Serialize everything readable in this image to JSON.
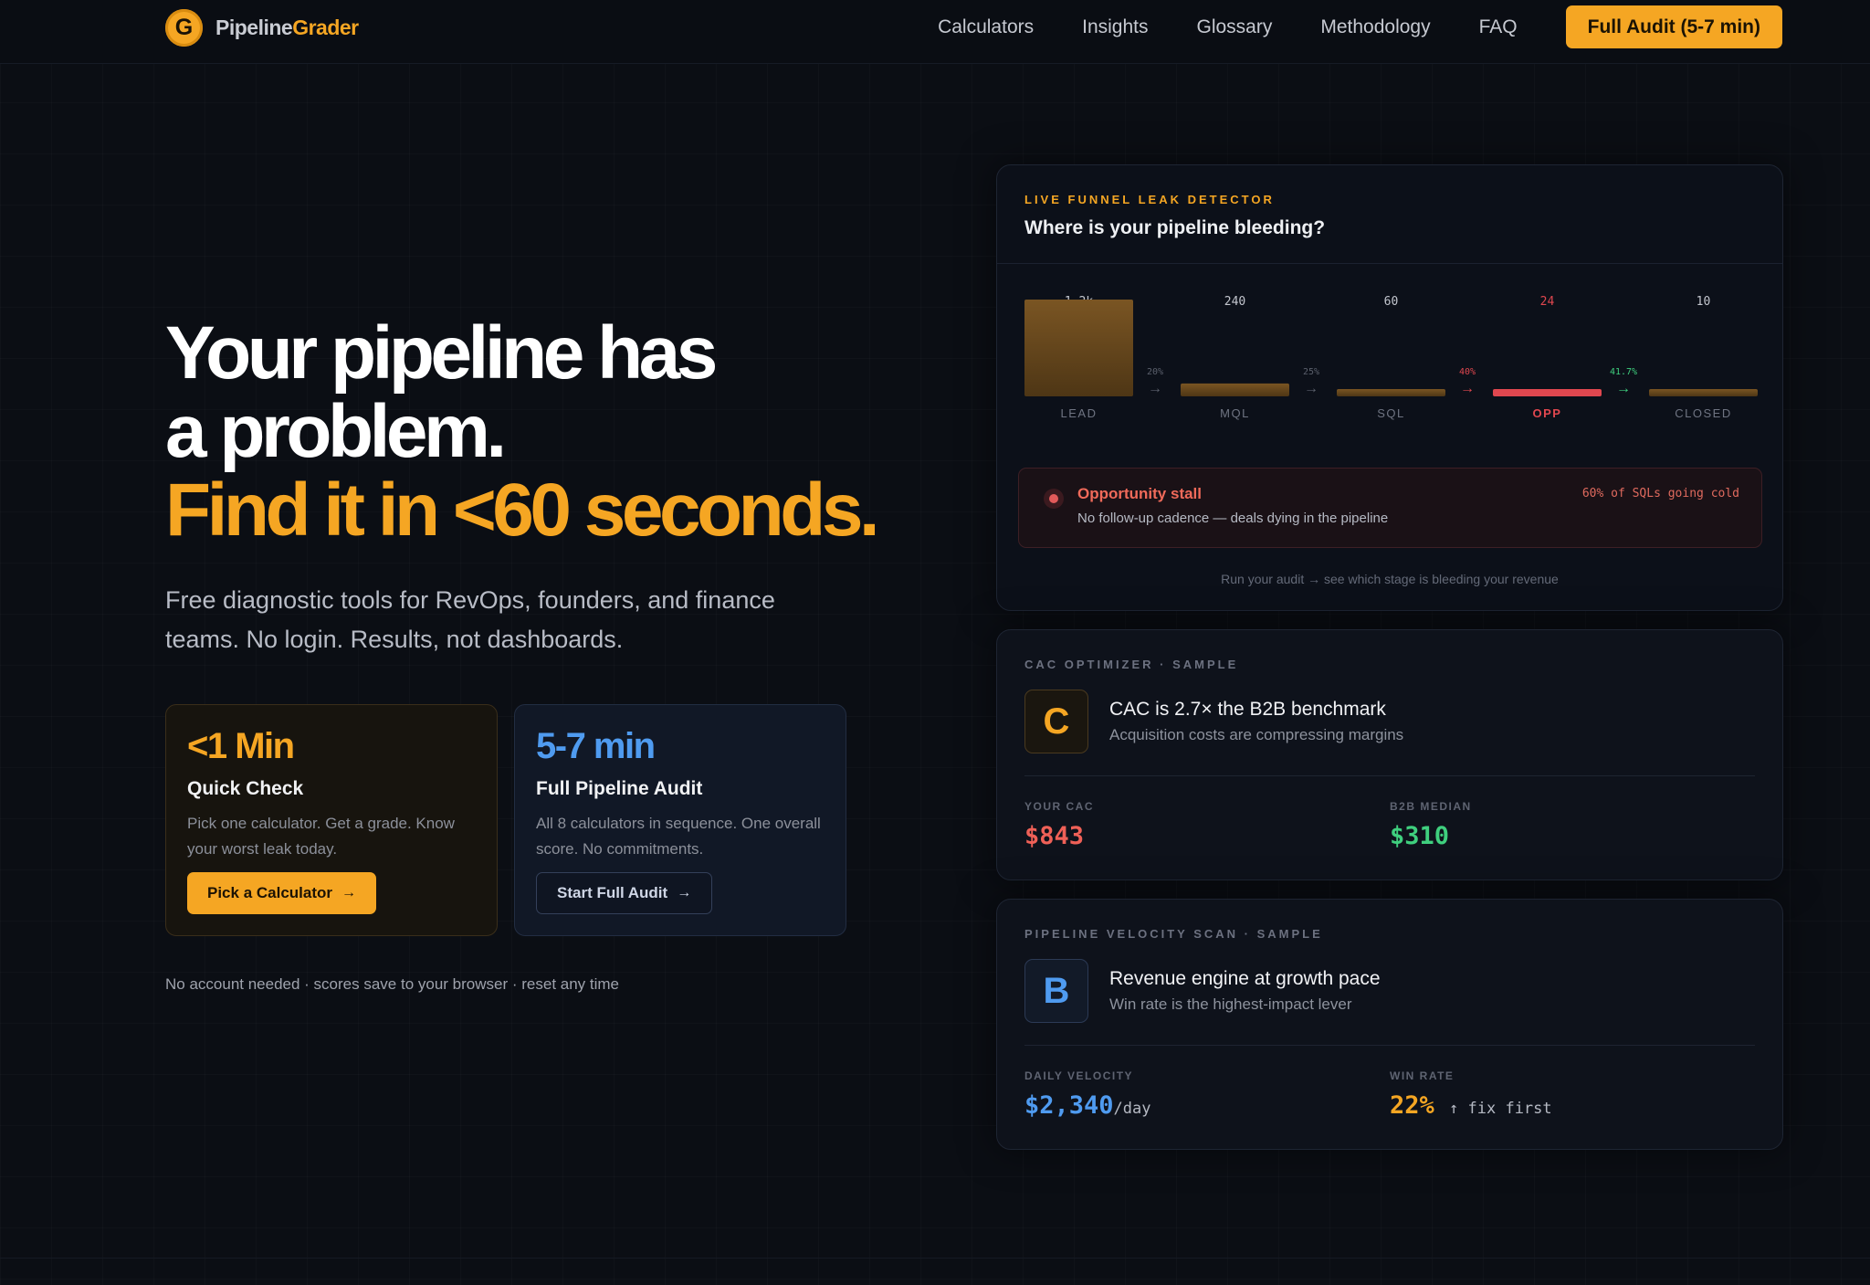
{
  "nav": {
    "logo_letter": "G",
    "brand_a": "Pipeline",
    "brand_b": "Grader",
    "links": [
      "Calculators",
      "Insights",
      "Glossary",
      "Methodology",
      "FAQ"
    ],
    "cta": "Full Audit (5-7 min)"
  },
  "hero": {
    "line1": "Your pipeline has",
    "line2": "a problem.",
    "line3": "Find it in <60 seconds.",
    "sub": "Free diagnostic tools for RevOps, founders, and finance teams. No login. Results, not dashboards.",
    "note": "No account needed · scores save to your browser · reset any time"
  },
  "cards": {
    "quick": {
      "big": "<1 Min",
      "title": "Quick Check",
      "desc": "Pick one calculator. Get a grade. Know your worst leak today.",
      "button": "Pick a Calculator"
    },
    "full": {
      "big": "5-7 min",
      "title": "Full Pipeline Audit",
      "desc": "All 8 calculators in sequence. One overall score. No commitments.",
      "button": "Start Full Audit"
    }
  },
  "funnel": {
    "eyebrow": "LIVE FUNNEL LEAK DETECTOR",
    "title": "Where is your pipeline bleeding?",
    "alert_title": "Opportunity stall",
    "alert_desc": "No follow-up cadence — deals dying in the pipeline",
    "alert_stat": "60% of SQLs going cold",
    "footer": "Run your audit → see which stage is bleeding your revenue"
  },
  "chart_data": {
    "type": "bar",
    "title": "Where is your pipeline bleeding?",
    "categories": [
      "LEAD",
      "MQL",
      "SQL",
      "OPP",
      "CLOSED"
    ],
    "value_labels": [
      "1.2k",
      "240",
      "60",
      "24",
      "10"
    ],
    "values": [
      1200,
      240,
      60,
      24,
      10
    ],
    "conversion_labels": [
      "20%",
      "25%",
      "40%",
      "41.7%"
    ],
    "highlight": "OPP",
    "colors": {
      "bar": "#6b4a1e",
      "highlight": "#e0474f",
      "green": "#3fcf7e"
    }
  },
  "cac": {
    "eyebrow": "CAC OPTIMIZER · SAMPLE",
    "grade": "C",
    "title": "CAC is 2.7× the B2B benchmark",
    "desc": "Acquisition costs are compressing margins",
    "m1_label": "YOUR CAC",
    "m1_value": "$843",
    "m2_label": "B2B MEDIAN",
    "m2_value": "$310"
  },
  "velocity": {
    "eyebrow": "PIPELINE VELOCITY SCAN · SAMPLE",
    "grade": "B",
    "title": "Revenue engine at growth pace",
    "desc": "Win rate is the highest-impact lever",
    "m1_label": "DAILY VELOCITY",
    "m1_value": "$2,340",
    "m1_suffix": "/day",
    "m2_label": "WIN RATE",
    "m2_value": "22%",
    "m2_suffix": "↑ fix first"
  }
}
